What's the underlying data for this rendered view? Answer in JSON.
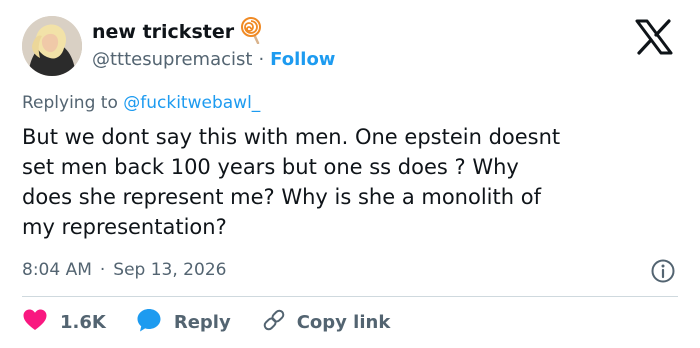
{
  "author": {
    "display_name": "new trickster",
    "handle": "@tttesupremacist",
    "separator": "·",
    "follow_label": "Follow",
    "name_emoji_icon": "lollipop-icon"
  },
  "reply_context": {
    "prefix": "Replying to",
    "mention": "@fuckitwebawl_"
  },
  "tweet": {
    "text": "But we dont say this with men. One epstein doesnt\nset men back 100 years but one ss does ? Why\ndoes she represent me? Why is she a monolith of\nmy representation?",
    "time": "8:04 AM",
    "separator": "·",
    "date": "Sep 13, 2026"
  },
  "actions": {
    "likes_count": "1.6K",
    "reply_label": "Reply",
    "copy_link_label": "Copy link"
  },
  "colors": {
    "accent": "#1d9bf0",
    "like": "#f91880",
    "text": "#0f1419",
    "secondary": "#536471",
    "divider": "#cfd9de"
  },
  "icons": [
    "lollipop-icon",
    "x-logo-icon",
    "info-icon",
    "heart-icon",
    "reply-bubble-icon",
    "link-icon"
  ]
}
